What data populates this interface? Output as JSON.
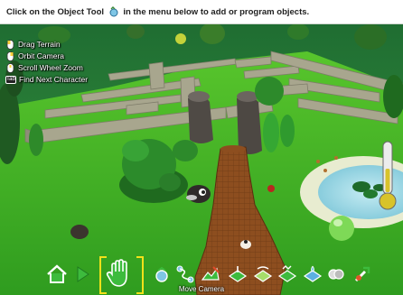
{
  "banner": {
    "text_before": "Click on the Object Tool",
    "text_after": "in the menu below to add or program objects.",
    "icon": "object-tool-icon"
  },
  "help": [
    {
      "icon": "mouse-left-icon",
      "label": "Drag Terrain"
    },
    {
      "icon": "mouse-right-icon",
      "label": "Orbit Camera"
    },
    {
      "icon": "mouse-wheel-icon",
      "label": "Scroll Wheel Zoom"
    },
    {
      "key": "Tab",
      "label": "Find Next Character"
    }
  ],
  "toolbar": {
    "caption": "Move Camera",
    "selected": "move-camera",
    "tools": [
      "home",
      "play",
      "move-camera",
      "object-tool",
      "paths-tool",
      "terrain-paint",
      "terrain-raise",
      "terrain-smooth",
      "terrain-roughen",
      "water-tool",
      "delete-tool",
      "world-settings"
    ]
  },
  "colors": {
    "grass": "#4cbf2a",
    "wall": "#a7a58c",
    "dirt": "#8a4b1e",
    "sky": "#2e7d3d",
    "selection": "#f2e11a",
    "water": "#9bd8e6"
  }
}
